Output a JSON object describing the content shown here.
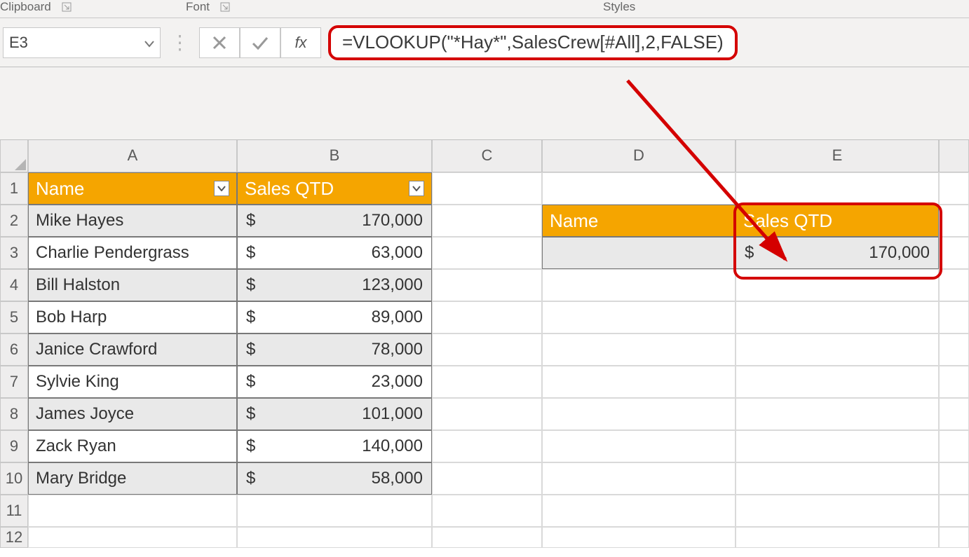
{
  "ribbon": {
    "clipboard_label": "Clipboard",
    "font_label": "Font",
    "styles_label": "Styles"
  },
  "namebox": {
    "value": "E3"
  },
  "formula_bar": {
    "fx_label": "fx",
    "formula": "=VLOOKUP(\"*Hay*\",SalesCrew[#All],2,FALSE)"
  },
  "columns": [
    "A",
    "B",
    "C",
    "D",
    "E"
  ],
  "rows": [
    "1",
    "2",
    "3",
    "4",
    "5",
    "6",
    "7",
    "8",
    "9",
    "10",
    "11",
    "12"
  ],
  "main_table": {
    "headers": {
      "name": "Name",
      "sales": "Sales QTD"
    },
    "rows": [
      {
        "name": "Mike Hayes",
        "currency": "$",
        "sales": "170,000"
      },
      {
        "name": "Charlie Pendergrass",
        "currency": "$",
        "sales": "63,000"
      },
      {
        "name": "Bill Halston",
        "currency": "$",
        "sales": "123,000"
      },
      {
        "name": "Bob Harp",
        "currency": "$",
        "sales": "89,000"
      },
      {
        "name": "Janice Crawford",
        "currency": "$",
        "sales": "78,000"
      },
      {
        "name": "Sylvie King",
        "currency": "$",
        "sales": "23,000"
      },
      {
        "name": "James Joyce",
        "currency": "$",
        "sales": "101,000"
      },
      {
        "name": "Zack Ryan",
        "currency": "$",
        "sales": "140,000"
      },
      {
        "name": "Mary Bridge",
        "currency": "$",
        "sales": "58,000"
      }
    ]
  },
  "lookup_table": {
    "headers": {
      "name": "Name",
      "sales": "Sales QTD"
    },
    "result": {
      "name": "",
      "currency": "$",
      "sales": "170,000"
    }
  },
  "chart_data": {
    "type": "table",
    "title": "SalesCrew — Sales QTD",
    "columns": [
      "Name",
      "Sales QTD (USD)"
    ],
    "rows": [
      [
        "Mike Hayes",
        170000
      ],
      [
        "Charlie Pendergrass",
        63000
      ],
      [
        "Bill Halston",
        123000
      ],
      [
        "Bob Harp",
        89000
      ],
      [
        "Janice Crawford",
        78000
      ],
      [
        "Sylvie King",
        23000
      ],
      [
        "James Joyce",
        101000
      ],
      [
        "Zack Ryan",
        140000
      ],
      [
        "Mary Bridge",
        58000
      ]
    ],
    "vlookup": {
      "formula": "=VLOOKUP(\"*Hay*\",SalesCrew[#All],2,FALSE)",
      "returns": 170000,
      "target_cell": "E3"
    }
  }
}
